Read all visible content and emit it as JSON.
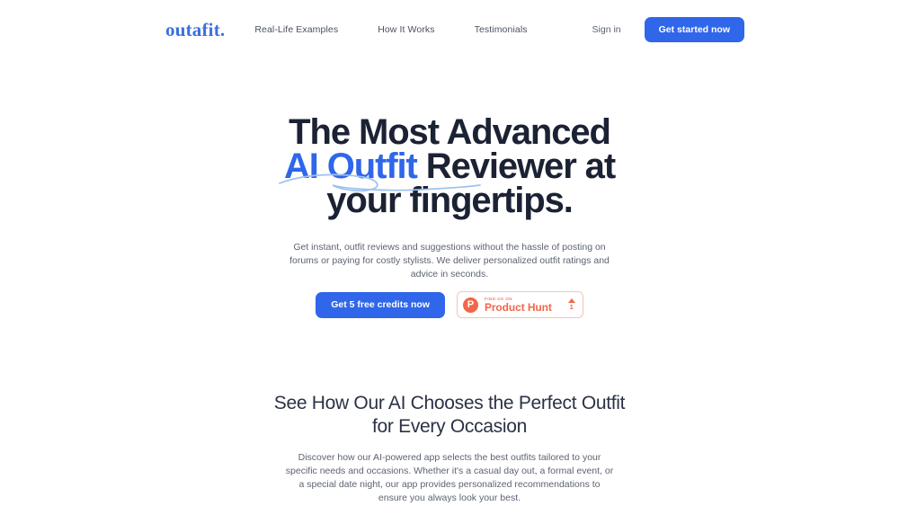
{
  "header": {
    "brand": "outafit.",
    "nav": [
      {
        "label": "Real-Life Examples"
      },
      {
        "label": "How It Works"
      },
      {
        "label": "Testimonials"
      }
    ],
    "signin_label": "Sign in",
    "cta_label": "Get started now"
  },
  "hero": {
    "title_line1": "The Most Advanced",
    "title_highlight": "AI Outfit",
    "title_after_highlight": " Reviewer at your",
    "title_line3": "fingertips.",
    "subtitle": "Get instant, outfit reviews and suggestions without the hassle of posting on forums or paying for costly stylists. We deliver personalized outfit ratings and advice in seconds.",
    "cta_primary": "Get 5 free credits now",
    "product_hunt": {
      "eyebrow": "FIND US ON",
      "name": "Product Hunt",
      "upvote_count": "1",
      "logo_letter": "P"
    }
  },
  "section2": {
    "title_line1": "See How Our AI Chooses the Perfect",
    "title_line2": "Outfit for Every Occasion",
    "body": "Discover how our AI-powered app selects the best outfits tailored to your specific needs and occasions. Whether it's a casual day out, a formal event, or a special date night, our app provides personalized recommendations to ensure you always look your best."
  },
  "colors": {
    "brand_blue": "#3b6fe0",
    "accent_blue": "#2f66ea",
    "heading_dark": "#1b2234",
    "body_gray": "#5c6372",
    "product_hunt_red": "#f2664a",
    "swoosh_blue": "#9dc2f2",
    "background": "#ffffff"
  }
}
